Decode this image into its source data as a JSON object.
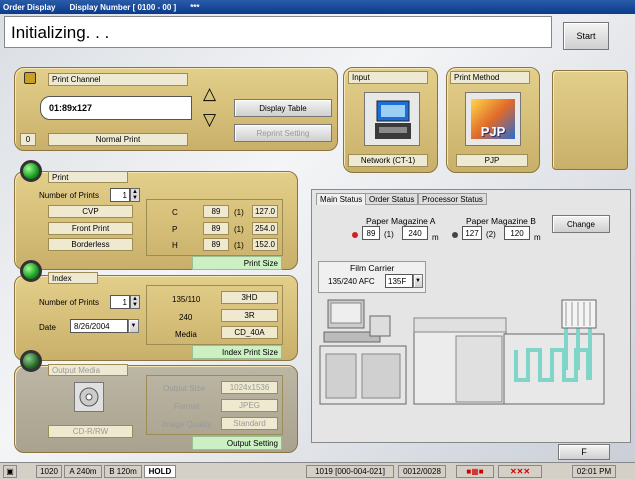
{
  "title": {
    "app": "Order Display",
    "display_number": "Display Number [ 0100 - 00 ]",
    "extra": "***"
  },
  "status_message": "Initializing. . .",
  "start_label": "Start",
  "f_label": "F",
  "print_channel": {
    "label": "Print Channel",
    "value": "01:89x127",
    "num": "0",
    "type": "Normal Print"
  },
  "buttons": {
    "display_table": "Display Table",
    "reprint": "Reprint Setting",
    "change": "Change"
  },
  "input": {
    "label": "Input",
    "value": "Network (CT-1)"
  },
  "print_method": {
    "label": "Print Method",
    "value": "PJP",
    "logo_text": "PJP"
  },
  "print": {
    "label": "Print",
    "num_prints_label": "Number of Prints",
    "num_prints": "1",
    "options": [
      "CVP",
      "Front Print",
      "Borderless"
    ],
    "rows": [
      {
        "code": "C",
        "w": "89",
        "n": "(1)",
        "h": "127.0"
      },
      {
        "code": "P",
        "w": "89",
        "n": "(1)",
        "h": "254.0"
      },
      {
        "code": "H",
        "w": "89",
        "n": "(1)",
        "h": "152.0"
      }
    ],
    "size_label": "Print Size"
  },
  "index": {
    "label": "Index",
    "num_prints_label": "Number of Prints",
    "num_prints": "1",
    "date_label": "Date",
    "date": "8/26/2004",
    "rows": [
      {
        "k": "135/110",
        "v": "3HD"
      },
      {
        "k": "240",
        "v": "3R"
      },
      {
        "k": "Media",
        "v": "CD_40A"
      }
    ],
    "size_label": "Index Print Size"
  },
  "output_media": {
    "label": "Output Media",
    "device": "CD-R/RW",
    "rows": [
      {
        "k": "Output Size",
        "v": "1024x1536"
      },
      {
        "k": "Format",
        "v": "JPEG"
      },
      {
        "k": "Image Quality",
        "v": "Standard"
      }
    ],
    "setting_label": "Output Setting"
  },
  "tabs": [
    "Main Status",
    "Order Status",
    "Processor Status"
  ],
  "magazine_a": {
    "label": "Paper Magazine A",
    "v1": "89",
    "v2": "(1)",
    "v3": "240",
    "unit": "m"
  },
  "magazine_b": {
    "label": "Paper Magazine B",
    "v1": "127",
    "v2": "(2)",
    "v3": "120",
    "unit": "m"
  },
  "film_carrier": {
    "label": "Film Carrier",
    "type": "135/240 AFC",
    "value": "135F"
  },
  "statusbar": {
    "num": "1020",
    "a": "A 240m",
    "b": "B 120m",
    "hold": "HOLD",
    "code": "1019 [000-004-021]",
    "count": "0012/0028",
    "time": "02:01 PM"
  },
  "colors": {
    "panel": "#d9c27a",
    "title": "#0a3a8a",
    "led": "#1a9a20",
    "green_bar": "#ccefc4"
  }
}
